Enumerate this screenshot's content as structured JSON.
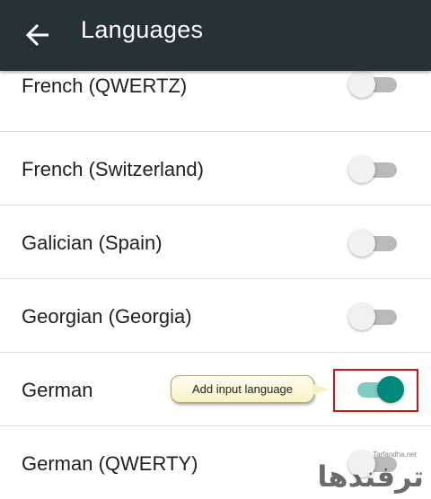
{
  "app_bar": {
    "title": "Languages",
    "back_icon": "arrow-back-icon",
    "background": "#263238"
  },
  "languages": [
    {
      "label": "French (QWERTZ)",
      "enabled": false
    },
    {
      "label": "French (Switzerland)",
      "enabled": false
    },
    {
      "label": "Galician (Spain)",
      "enabled": false
    },
    {
      "label": "Georgian (Georgia)",
      "enabled": false
    },
    {
      "label": "German",
      "enabled": true
    },
    {
      "label": "German (QWERTY)",
      "enabled": false
    }
  ],
  "callout": {
    "text": "Add input language"
  },
  "watermark": {
    "text": "ترفندها",
    "url": "Tarfandha.net"
  },
  "colors": {
    "switch_on": "#00897b",
    "switch_on_track": "#80cbc4",
    "switch_off_track": "#b9b9b9",
    "highlight": "#c8161d"
  }
}
